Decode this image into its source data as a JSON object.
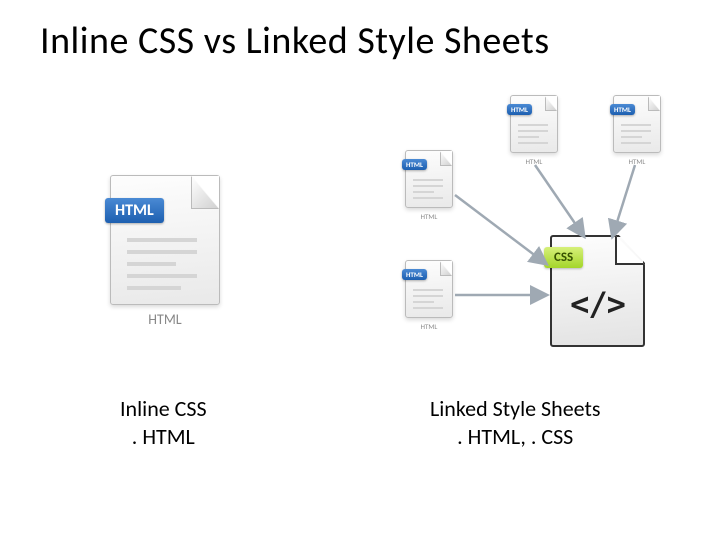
{
  "title": "Inline CSS vs Linked Style Sheets",
  "captions": {
    "left_line1": "Inline CSS",
    "left_line2": ". HTML",
    "right_line1": "Linked Style Sheets",
    "right_line2": ". HTML, . CSS"
  },
  "badges": {
    "html": "HTML",
    "css": "CSS"
  },
  "labels": {
    "html_ext": "HTML"
  },
  "glyph": {
    "css_code": "</>"
  },
  "colors": {
    "html_badge": "#2f6fbf",
    "css_badge": "#a4d62a"
  }
}
